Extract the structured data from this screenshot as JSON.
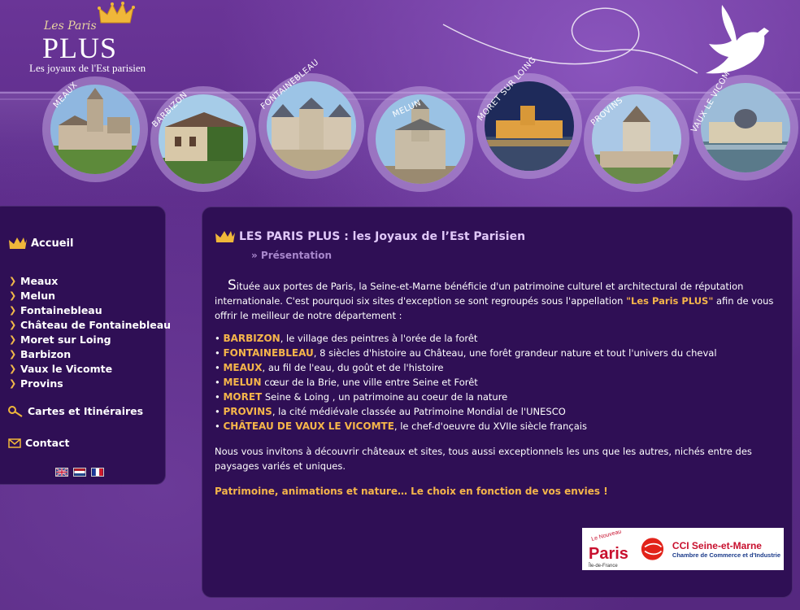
{
  "header": {
    "logo_script": "Les Paris",
    "logo_plus": "PLUS",
    "logo_tagline": "Les joyaux de l'Est parisien"
  },
  "sites": [
    {
      "label": "MEAUX"
    },
    {
      "label": "BARBIZON"
    },
    {
      "label": "FONTAINEBLEAU"
    },
    {
      "label": "MELUN"
    },
    {
      "label": "MORET SUR LOING"
    },
    {
      "label": "PROVINS"
    },
    {
      "label": "VAUX LE VICOMTE"
    }
  ],
  "sidebar": {
    "home": "Accueil",
    "items": [
      {
        "label": "Meaux"
      },
      {
        "label": "Melun"
      },
      {
        "label": "Fontainebleau"
      },
      {
        "label": "Château de Fontainebleau"
      },
      {
        "label": "Moret sur Loing"
      },
      {
        "label": "Barbizon"
      },
      {
        "label": "Vaux le Vicomte"
      },
      {
        "label": "Provins"
      }
    ],
    "maps": "Cartes et Itinéraires",
    "contact": "Contact",
    "flags": [
      "english-flag",
      "dutch-flag",
      "french-flag"
    ]
  },
  "main": {
    "title": "LES PARIS PLUS : les Joyaux de l’Est Parisien",
    "breadcrumb": "» Présentation",
    "intro_dropcap": "S",
    "intro_before": "ituée aux portes de Paris, la Seine-et-Marne bénéficie d'un patrimoine culturel et architectural de réputation internationale. C'est pourquoi six sites d'exception se sont regroupés sous l'appellation ",
    "intro_highlight": "\"Les Paris PLUS\"",
    "intro_after": " afin de vous offrir le meilleur de notre département :",
    "bullets": [
      {
        "name": "BARBIZON",
        "text": ", le village des peintres à l'orée de la forêt"
      },
      {
        "name": "FONTAINEBLEAU",
        "text": ", 8 siècles d'histoire au Château, une forêt grandeur nature et tout l'univers du cheval"
      },
      {
        "name": "MEAUX",
        "text": ", au fil de l'eau, du goût et de l'histoire"
      },
      {
        "name": "MELUN",
        "text": " cœur de la Brie, une ville entre Seine et Forêt"
      },
      {
        "name": "MORET",
        "text": " Seine & Loing , un patrimoine au coeur de la nature"
      },
      {
        "name": "PROVINS",
        "text": ", la cité médiévale classée au Patrimoine Mondial de l'UNESCO"
      },
      {
        "name": "CHÂTEAU DE VAUX LE VICOMTE",
        "text": ", le chef-d'oeuvre du XVIIe siècle français"
      }
    ],
    "invite": "Nous vous invitons à découvrir châteaux et sites, tous aussi exceptionnels les uns que les autres, nichés entre des paysages variés et uniques.",
    "slogan": "Patrimoine, animations et nature… Le choix en fonction de vos envies !"
  },
  "partners": {
    "paris_small": "Le Nouveau",
    "paris_big": "Paris",
    "paris_region": "Île-de-France",
    "cci_title": "CCI Seine-et-Marne",
    "cci_sub": "Chambre de Commerce et d'Industrie"
  },
  "colors": {
    "accent": "#f5b54a",
    "panel": "#2f0f55",
    "background": "#5a2a86"
  }
}
